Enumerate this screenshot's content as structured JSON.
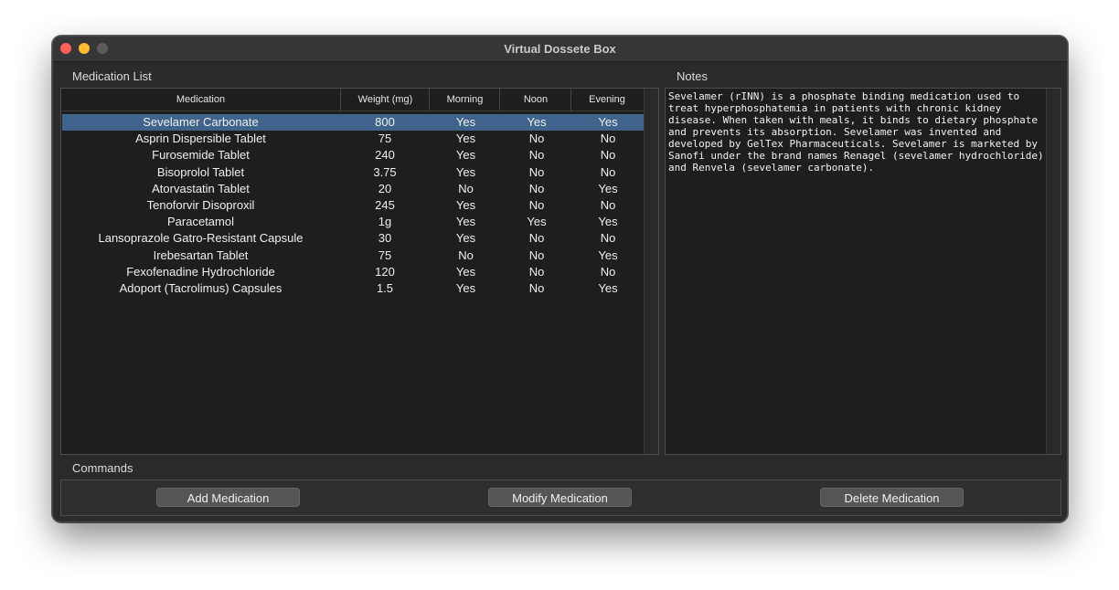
{
  "window": {
    "title": "Virtual Dossete Box"
  },
  "medication_list": {
    "label": "Medication List",
    "columns": [
      "Medication",
      "Weight (mg)",
      "Morning",
      "Noon",
      "Evening"
    ],
    "rows": [
      [
        "Sevelamer Carbonate",
        "800",
        "Yes",
        "Yes",
        "Yes"
      ],
      [
        "Asprin Dispersible Tablet",
        "75",
        "Yes",
        "No",
        "No"
      ],
      [
        "Furosemide Tablet",
        "240",
        "Yes",
        "No",
        "No"
      ],
      [
        "Bisoprolol Tablet",
        "3.75",
        "Yes",
        "No",
        "No"
      ],
      [
        "Atorvastatin Tablet",
        "20",
        "No",
        "No",
        "Yes"
      ],
      [
        "Tenoforvir Disoproxil",
        "245",
        "Yes",
        "No",
        "No"
      ],
      [
        "Paracetamol",
        "1g",
        "Yes",
        "Yes",
        "Yes"
      ],
      [
        "Lansoprazole Gatro-Resistant Capsule",
        "30",
        "Yes",
        "No",
        "No"
      ],
      [
        "Irebesartan Tablet",
        "75",
        "No",
        "No",
        "Yes"
      ],
      [
        "Fexofenadine Hydrochloride",
        "120",
        "Yes",
        "No",
        "No"
      ],
      [
        "Adoport (Tacrolimus) Capsules",
        "1.5",
        "Yes",
        "No",
        "Yes"
      ]
    ],
    "selected_row": 0
  },
  "notes": {
    "label": "Notes",
    "text": "Sevelamer (rINN) is a phosphate binding medication used to treat hyperphosphatemia in patients with chronic kidney disease. When taken with meals, it binds to dietary phosphate and prevents its absorption. Sevelamer was invented and developed by GelTex Pharmaceuticals. Sevelamer is marketed by Sanofi under the brand names Renagel (sevelamer hydrochloride) and Renvela (sevelamer carbonate)."
  },
  "commands": {
    "label": "Commands",
    "add_label": "Add Medication",
    "modify_label": "Modify Medication",
    "delete_label": "Delete Medication"
  },
  "colors": {
    "selection": "#3f638b",
    "window_bg": "#2b2b2b",
    "panel_bg": "#1e1e1e",
    "close": "#ff5f57",
    "minimize": "#febc2e"
  }
}
